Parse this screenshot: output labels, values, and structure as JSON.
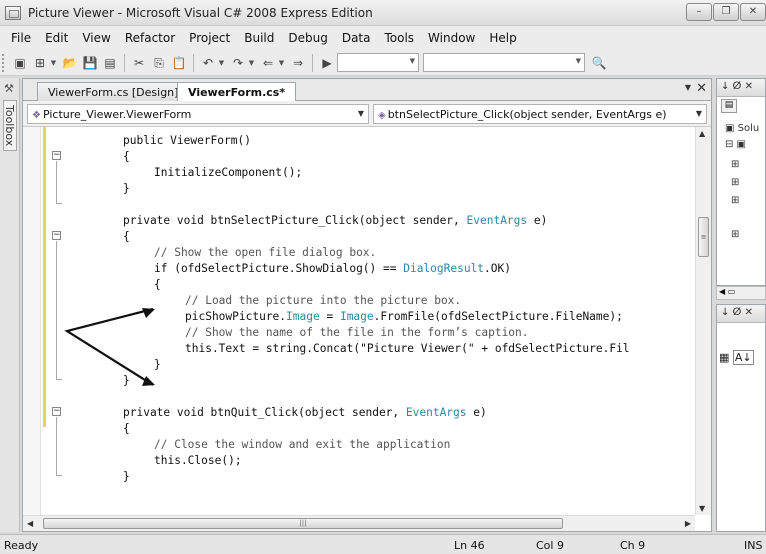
{
  "window": {
    "title": "Picture Viewer - Microsoft Visual C# 2008 Express Edition",
    "controls": [
      "–",
      "❐",
      "✕"
    ]
  },
  "menu": [
    "File",
    "Edit",
    "View",
    "Refactor",
    "Project",
    "Build",
    "Debug",
    "Data",
    "Tools",
    "Window",
    "Help"
  ],
  "toolbox": {
    "label": "Toolbox"
  },
  "tabs": [
    {
      "label": "ViewerForm.cs [Design]*",
      "active": false
    },
    {
      "label": "ViewerForm.cs*",
      "active": true
    }
  ],
  "tab_close": "✕",
  "nav": {
    "class_combo": "Picture_Viewer.ViewerForm",
    "member_combo": "btnSelectPicture_Click(object sender, EventArgs e)"
  },
  "code": [
    {
      "indent": 0,
      "text": "public ViewerForm()"
    },
    {
      "indent": 0,
      "text": "{"
    },
    {
      "indent": 1,
      "text": "InitializeComponent();"
    },
    {
      "indent": 0,
      "text": "}"
    },
    {
      "indent": 0,
      "text": ""
    },
    {
      "indent": 0,
      "text": "private void btnSelectPicture_Click(object sender, EventArgs e)"
    },
    {
      "indent": 0,
      "text": "{"
    },
    {
      "indent": 1,
      "text": "// Show the open file dialog box."
    },
    {
      "indent": 1,
      "text": "if (ofdSelectPicture.ShowDialog() == DialogResult.OK)"
    },
    {
      "indent": 1,
      "text": "{"
    },
    {
      "indent": 2,
      "text": "// Load the picture into the picture box."
    },
    {
      "indent": 2,
      "text": "picShowPicture.Image = Image.FromFile(ofdSelectPicture.FileName);"
    },
    {
      "indent": 2,
      "text": "// Show the name of the file in the form’s caption."
    },
    {
      "indent": 2,
      "text": "this.Text = string.Concat(\"Picture Viewer(\" + ofdSelectPicture.Fil"
    },
    {
      "indent": 1,
      "text": "}"
    },
    {
      "indent": 0,
      "text": "}"
    },
    {
      "indent": 0,
      "text": ""
    },
    {
      "indent": 0,
      "text": "private void btnQuit_Click(object sender, EventArgs e)"
    },
    {
      "indent": 0,
      "text": "{"
    },
    {
      "indent": 1,
      "text": "// Close the window and exit the application"
    },
    {
      "indent": 1,
      "text": "this.Close();"
    },
    {
      "indent": 0,
      "text": "}"
    }
  ],
  "solution_panel": {
    "header": "↓ ⵁ ✕",
    "item": "Solu"
  },
  "properties_panel": {
    "header": "↓ ⵁ ✕"
  },
  "status": {
    "ready": "Ready",
    "line": "Ln 46",
    "col": "Col 9",
    "ch": "Ch 9",
    "mode": "INS"
  },
  "colors": {
    "type": "#2a8aa6",
    "comment": "#555555",
    "changed_margin": "#e7d35a"
  }
}
